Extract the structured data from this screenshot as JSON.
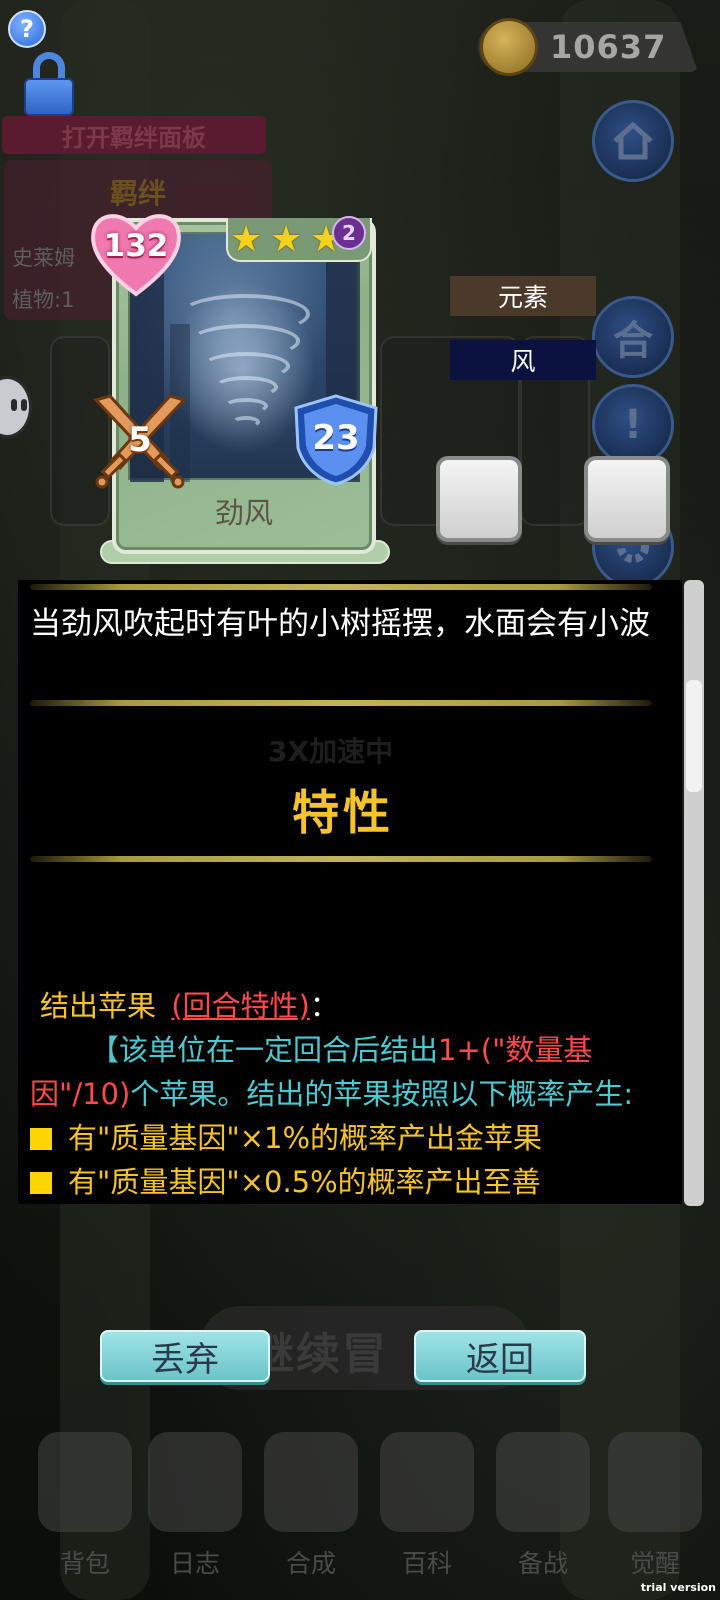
{
  "top": {
    "coins": "10637",
    "bond_open_label": "打开羁绊面板",
    "bond_title": "羁绊",
    "bond_lines": [
      "史莱姆",
      "植物:1"
    ]
  },
  "card": {
    "hp": "132",
    "attack": "5",
    "defense": "23",
    "stars": 3,
    "star_level": "2",
    "name": "劲风"
  },
  "element": {
    "label": "元素",
    "value": "风"
  },
  "description": {
    "flavor": "当劲风吹起时有叶的小树摇摆，水面会有小波",
    "ghost_text": "3X加速中",
    "trait_heading": "特性",
    "trait_name": "结出苹果",
    "trait_type": "(回合特性)",
    "trait_colon": "：",
    "trait_intro_bracket": "【该单位在一定回合后结出",
    "trait_formula": "1+(\"数量基因\"/10)",
    "trait_intro_rest": "个苹果。结出的苹果按照以下概率产生:",
    "bullet1_a": "有",
    "bullet1_b": "\"质量基因\"×1%",
    "bullet1_c": "的概率产出金苹果",
    "bullet2_a": "有",
    "bullet2_b": "\"质量基因\"×0.5%",
    "bullet2_c": "的概率产出至善"
  },
  "buttons": {
    "discard": "丢弃",
    "back": "返回",
    "continue_ghost": "继续冒"
  },
  "nav": [
    {
      "label": "背包"
    },
    {
      "label": "日志"
    },
    {
      "label": "合成"
    },
    {
      "label": "百科"
    },
    {
      "label": "备战"
    },
    {
      "label": "觉醒"
    }
  ],
  "watermark": "trial version",
  "colors": {
    "trait_heading": "#f6c42a",
    "trait_type": "#ff4a4a",
    "trait_body": "#4cc9d0",
    "bullet": "#ffd400"
  }
}
